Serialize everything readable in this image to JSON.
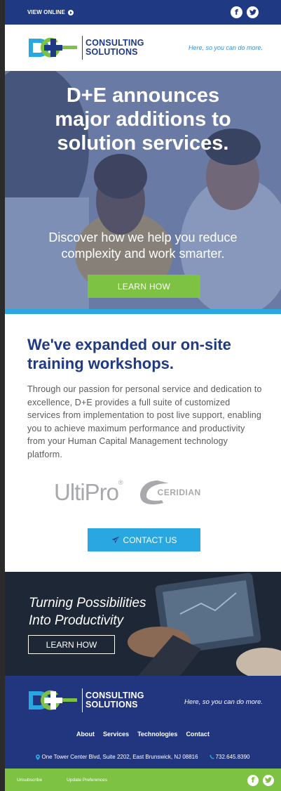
{
  "topbar": {
    "view_online": "VIEW ONLINE",
    "facebook_glyph": "f",
    "twitter_glyph": "t"
  },
  "header": {
    "logo_line1": "CONSULTING",
    "logo_line2": "SOLUTIONS",
    "tagline": "Here, so you can do more."
  },
  "hero": {
    "title_lines": [
      "D+E announces",
      "major additions to",
      "solution services."
    ],
    "subtitle_lines": [
      "Discover how we help you reduce",
      "complexity and work smarter."
    ],
    "cta": "LEARN HOW"
  },
  "content": {
    "heading_lines": [
      "We've expanded our on-site",
      "training workshops."
    ],
    "body": "Through our passion for personal service and dedication to excellence, D+E provides a full suite of customized services from implementation to post live support, enabling you to achieve maximum performance and productivity from your Human Capital Management technology platform.",
    "partner1": "UltiPro",
    "partner2": "CERIDIAN",
    "cta": "CONTACT US"
  },
  "promo": {
    "title_lines": [
      "Turning Possibilities",
      "Into Productivity"
    ],
    "cta": "LEARN HOW"
  },
  "footer": {
    "logo_line1": "CONSULTING",
    "logo_line2": "SOLUTIONS",
    "tagline": "Here, so you can do more.",
    "nav": [
      "About",
      "Services",
      "Technologies",
      "Contact"
    ],
    "address": "One Tower Center Blvd, Suite 2202, East Brunswick, NJ 08816",
    "phone": "732.645.8390"
  },
  "bottombar": {
    "unsubscribe": "Unsubscribe",
    "preferences": "Update Preferences"
  },
  "colors": {
    "navy": "#1f3a82",
    "green": "#7dc242",
    "blue": "#29a7e1"
  },
  "icons": [
    "play-circle-icon",
    "facebook-icon",
    "twitter-icon",
    "location-pin-icon",
    "phone-icon",
    "paper-plane-icon"
  ]
}
